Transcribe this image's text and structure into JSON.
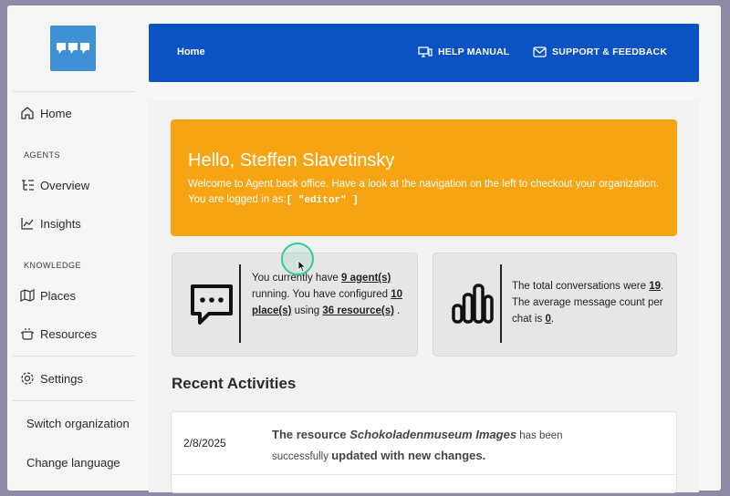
{
  "sidebar": {
    "home": "Home",
    "section_agents": "AGENTS",
    "overview": "Overview",
    "insights": "Insights",
    "section_knowledge": "KNOWLEDGE",
    "places": "Places",
    "resources": "Resources",
    "settings": "Settings",
    "switch_org": "Switch organization",
    "change_lang": "Change language"
  },
  "topbar": {
    "home": "Home",
    "help": "HELP MANUAL",
    "support": "SUPPORT & FEEDBACK"
  },
  "welcome": {
    "title": "Hello, Steffen Slavetinsky",
    "line1": "Welcome to Agent back office. Have a look at the navigation on the left to checkout your organization.",
    "logged_prefix": "You are logged in as:",
    "role": "[ \"editor\" ]"
  },
  "stats_agents": {
    "t1": "You currently have ",
    "agents_link": "9 agent(s)",
    "t2": " running. You have configured ",
    "places_link": "10 place(s)",
    "t3": " using ",
    "resources_link": "36 resource(s)",
    "t4": " ."
  },
  "stats_conv": {
    "t1": "The total conversations were ",
    "total": "19",
    "t2": ". The average message count per chat is ",
    "avg": "0",
    "t3": "."
  },
  "recent": {
    "title": "Recent Activities",
    "items": [
      {
        "date": "2/8/2025",
        "p1": "The resource ",
        "name": "Schokoladenmuseum Images",
        "p2": " has been successfully ",
        "p3": "updated with new changes."
      }
    ]
  }
}
